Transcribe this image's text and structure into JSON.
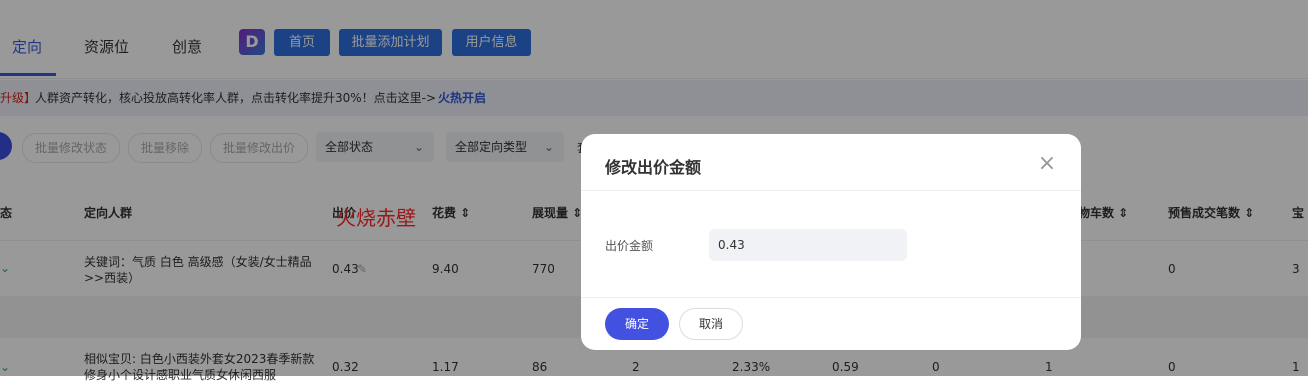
{
  "nav": {
    "tabs": [
      "定向",
      "资源位",
      "创意"
    ],
    "logo": "D",
    "buttons": [
      "首页",
      "批量添加计划",
      "用户信息"
    ]
  },
  "promo": {
    "tag": "升级】",
    "text": "人群资产转化，核心投放高转化率人群，点击转化率提升30%！点击这里->",
    "link": "火热开启"
  },
  "toolbar": {
    "batch_status": "批量修改状态",
    "batch_remove": "批量移除",
    "batch_bid": "批量修改出价",
    "status_filter": "全部状态",
    "type_filter": "全部定向类型",
    "extra": "套"
  },
  "table": {
    "headers": [
      "态",
      "定向人群",
      "出价",
      "花费",
      "展现量",
      "物车数",
      "预售成交笔数",
      "宝"
    ],
    "rows": [
      {
        "audience": "关键词：气质 白色 高级感（女装/女士精品>>西装）",
        "bid": "0.43",
        "cost": "9.40",
        "impressions": "770",
        "presale": "0",
        "last": "3"
      },
      {
        "audience": "相似宝贝: 白色小西装外套女2023春季新款修身小个设计感职业气质女休闲西服",
        "bid": "0.32",
        "cost": "1.17",
        "impressions": "86",
        "c4": "2",
        "c5": "2.33%",
        "c6": "0.59",
        "c7": "0",
        "c8": "1",
        "presale": "0",
        "last": "1"
      }
    ]
  },
  "watermark": "火烧赤壁",
  "modal": {
    "title": "修改出价金额",
    "field_label": "出价金额",
    "field_value": "0.43",
    "ok_label": "确定",
    "cancel_label": "取消"
  }
}
